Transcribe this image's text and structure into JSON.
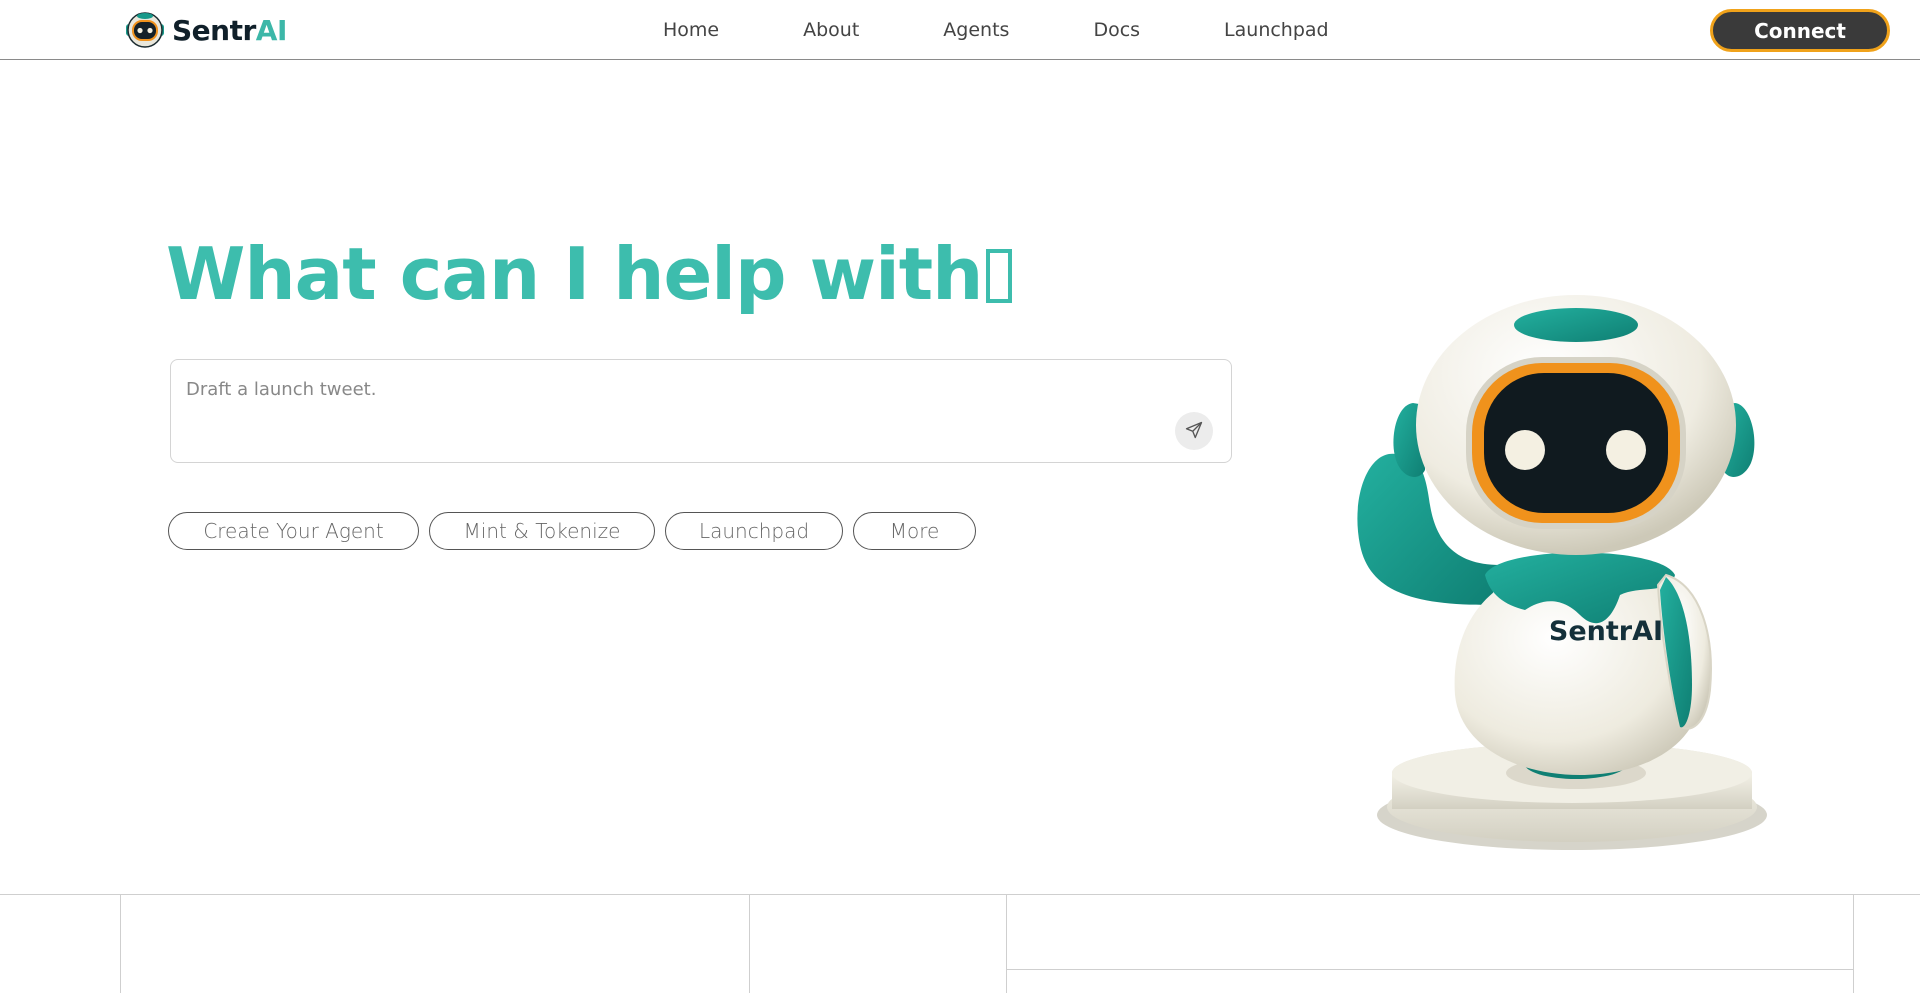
{
  "brand": {
    "name_part1": "Sentr",
    "name_part2": "AI",
    "accent_color": "#3dbdad",
    "logo_icon": "robot-head-icon"
  },
  "nav": {
    "items": [
      {
        "label": "Home"
      },
      {
        "label": "About"
      },
      {
        "label": "Agents"
      },
      {
        "label": "Docs"
      },
      {
        "label": "Launchpad"
      }
    ]
  },
  "header": {
    "connect_label": "Connect",
    "connect_bg": "#3a3a3a",
    "connect_border": "#f0a21a"
  },
  "hero": {
    "headline": "What can I help with",
    "prompt_placeholder": "Draft a launch tweet.",
    "send_icon": "send-icon",
    "chips": [
      {
        "label": "Create Your Agent"
      },
      {
        "label": "Mint & Tokenize"
      },
      {
        "label": "Launchpad"
      },
      {
        "label": "More"
      }
    ]
  },
  "mascot": {
    "shirt_text": "SentrAI",
    "body_color": "#f2f0e6",
    "teal_color": "#17998a",
    "visor_rim_color": "#f0921c"
  }
}
